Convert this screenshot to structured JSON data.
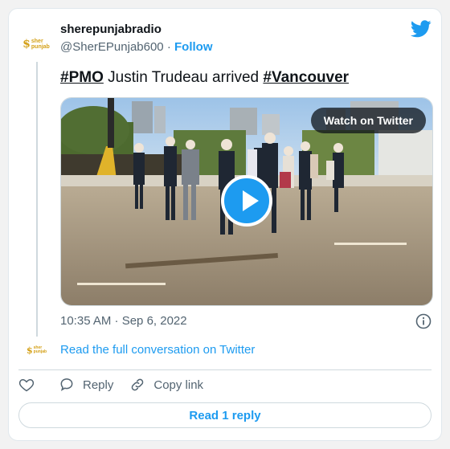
{
  "colors": {
    "accent": "#1d9bf0",
    "text": "#0f1419",
    "muted": "#536471",
    "border": "#cfd9de",
    "logo_gold": "#d4a017"
  },
  "author": {
    "display_name": "sherepunjabradio",
    "handle": "@SherEPunjab600",
    "separator": " · ",
    "follow_label": "Follow",
    "avatar_icon": "sherepunjab-logo"
  },
  "tweet": {
    "hashtag_1": "#PMO",
    "text_middle": " Justin Trudeau arrived ",
    "hashtag_2": "#Vancouver",
    "timestamp": "10:35 AM · Sep 6, 2022"
  },
  "media": {
    "watch_label": "Watch on Twitter",
    "play_icon": "play-icon"
  },
  "conversation": {
    "read_full_label": "Read the full conversation on Twitter"
  },
  "actions": {
    "like_icon": "heart-icon",
    "reply_label": "Reply",
    "copy_link_label": "Copy link"
  },
  "footer": {
    "read_replies_label": "Read 1 reply"
  }
}
